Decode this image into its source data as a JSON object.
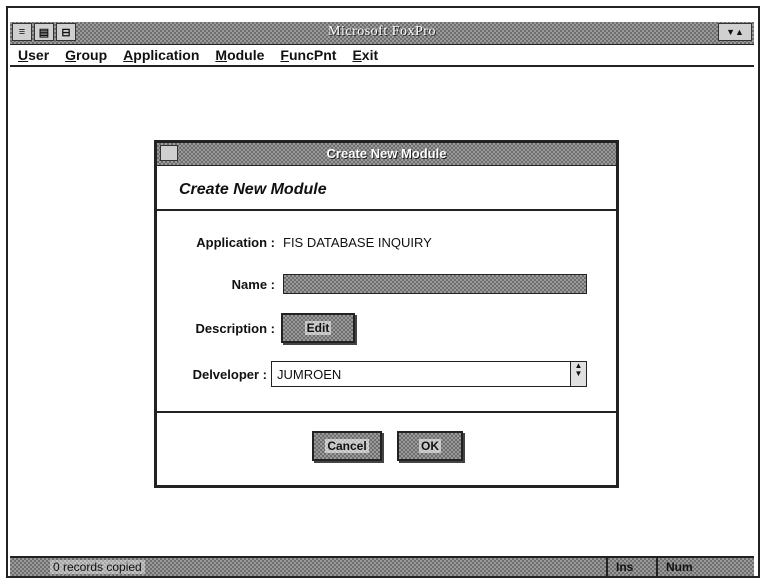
{
  "window": {
    "title": "Microsoft FoxPro",
    "control_left": "≡",
    "control_right": "▼▲"
  },
  "menu": [
    {
      "accel": "U",
      "rest": "ser"
    },
    {
      "accel": "G",
      "rest": "roup"
    },
    {
      "accel": "A",
      "rest": "pplication"
    },
    {
      "accel": "M",
      "rest": "odule"
    },
    {
      "accel": "F",
      "rest": "uncPnt"
    },
    {
      "accel": "E",
      "rest": "xit"
    }
  ],
  "dialog": {
    "title": "Create New Module",
    "heading": "Create New Module",
    "application_label": "Application :",
    "application_value": "FIS DATABASE INQUIRY",
    "name_label": "Name :",
    "name_value": "",
    "description_label": "Description :",
    "edit_button": "Edit",
    "developer_label": "Delveloper :",
    "developer_value": "JUMROEN",
    "cancel_button": "Cancel",
    "ok_button": "OK"
  },
  "status": {
    "message": "0  records copied",
    "ins": "Ins",
    "num": "Num"
  }
}
